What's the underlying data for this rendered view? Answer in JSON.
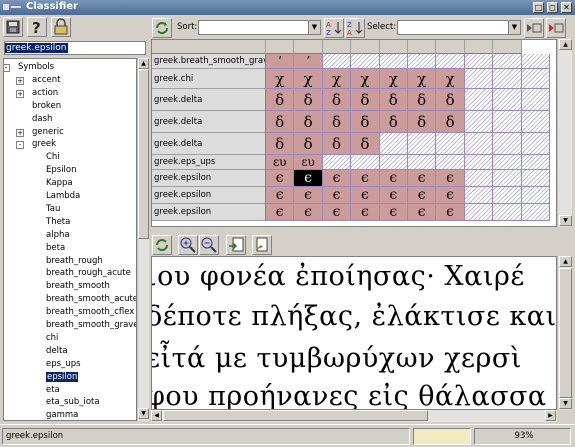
{
  "window": {
    "title": "Classifier",
    "controls": [
      "□",
      "◻",
      "✕"
    ]
  },
  "left": {
    "selected_value": "greek.epsilon",
    "tree": [
      {
        "label": "Symbols",
        "level": 0,
        "exp": "-"
      },
      {
        "label": "accent",
        "level": 1,
        "exp": "+"
      },
      {
        "label": "action",
        "level": 1,
        "exp": "+"
      },
      {
        "label": "broken",
        "level": 1,
        "exp": ""
      },
      {
        "label": "dash",
        "level": 1,
        "exp": ""
      },
      {
        "label": "generic",
        "level": 1,
        "exp": "+"
      },
      {
        "label": "greek",
        "level": 1,
        "exp": "-"
      },
      {
        "label": "Chi",
        "level": 2,
        "exp": ""
      },
      {
        "label": "Epsilon",
        "level": 2,
        "exp": ""
      },
      {
        "label": "Kappa",
        "level": 2,
        "exp": ""
      },
      {
        "label": "Lambda",
        "level": 2,
        "exp": ""
      },
      {
        "label": "Tau",
        "level": 2,
        "exp": ""
      },
      {
        "label": "Theta",
        "level": 2,
        "exp": ""
      },
      {
        "label": "alpha",
        "level": 2,
        "exp": ""
      },
      {
        "label": "beta",
        "level": 2,
        "exp": ""
      },
      {
        "label": "breath_rough",
        "level": 2,
        "exp": ""
      },
      {
        "label": "breath_rough_acute",
        "level": 2,
        "exp": ""
      },
      {
        "label": "breath_smooth",
        "level": 2,
        "exp": ""
      },
      {
        "label": "breath_smooth_acute",
        "level": 2,
        "exp": ""
      },
      {
        "label": "breath_smooth_cflex",
        "level": 2,
        "exp": ""
      },
      {
        "label": "breath_smooth_grave",
        "level": 2,
        "exp": ""
      },
      {
        "label": "chi",
        "level": 2,
        "exp": ""
      },
      {
        "label": "delta",
        "level": 2,
        "exp": ""
      },
      {
        "label": "eps_ups",
        "level": 2,
        "exp": ""
      },
      {
        "label": "epsilon",
        "level": 2,
        "exp": "",
        "selected": true
      },
      {
        "label": "eta",
        "level": 2,
        "exp": ""
      },
      {
        "label": "eta_sub_iota",
        "level": 2,
        "exp": ""
      },
      {
        "label": "gamma",
        "level": 2,
        "exp": ""
      }
    ]
  },
  "toolbar": {
    "sort_label": "Sort:",
    "select_label": "Select:",
    "sort_value": "",
    "select_value": ""
  },
  "grid": {
    "rows": [
      {
        "label": "greek.breath_smooth_grave",
        "glyph": "ʼ",
        "filled": 2
      },
      {
        "label": "greek.chi",
        "glyph": "χ",
        "filled": 7
      },
      {
        "label": "greek.delta",
        "glyph": "δ",
        "filled": 7
      },
      {
        "label": "greek.delta",
        "glyph": "δ",
        "filled": 7
      },
      {
        "label": "greek.delta",
        "glyph": "δ",
        "filled": 4
      },
      {
        "label": "greek.eps_ups",
        "glyph": "ευ",
        "filled": 2
      },
      {
        "label": "greek.epsilon",
        "glyph": "ϵ",
        "filled": 7,
        "selected_col": 1
      },
      {
        "label": "greek.epsilon",
        "glyph": "ϵ",
        "filled": 7
      },
      {
        "label": "greek.epsilon",
        "glyph": "ϵ",
        "filled": 7
      }
    ]
  },
  "document": {
    "lines": [
      "ιου φονέα ἐποίησας· Χαιρέ",
      "δέποτε πλήξας, ἐλάκτισε καιρ",
      "εἶτά με τυμβωρύχων χερσὶ",
      "φου προήνανες εἰς θάλασσα"
    ]
  },
  "status": {
    "left": "greek.epsilon",
    "zoom": "93%"
  }
}
